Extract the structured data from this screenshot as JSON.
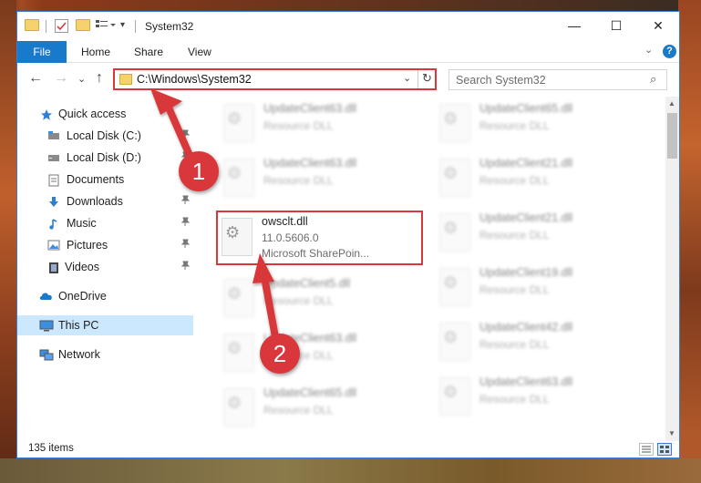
{
  "window": {
    "title": "System32",
    "controls": {
      "minimize": "—",
      "maximize": "☐",
      "close": "✕"
    }
  },
  "ribbon": {
    "tabs": [
      "File",
      "Home",
      "Share",
      "View"
    ],
    "expand_chevron": "⌄",
    "help": "?"
  },
  "address": {
    "back": "←",
    "forward": "→",
    "recent": "⌄",
    "up": "↑",
    "path": "C:\\Windows\\System32",
    "dropdown": "⌄",
    "refresh": "↻"
  },
  "search": {
    "placeholder": "Search System32",
    "icon": "⌕"
  },
  "sidebar": {
    "items": [
      {
        "label": "Quick access",
        "icon": "star-icon"
      },
      {
        "label": "Local Disk (C:)",
        "icon": "drive-icon",
        "pinned": true
      },
      {
        "label": "Local Disk (D:)",
        "icon": "drive-icon",
        "pinned": true
      },
      {
        "label": "Documents",
        "icon": "documents-icon",
        "pinned": true
      },
      {
        "label": "Downloads",
        "icon": "downloads-icon",
        "pinned": true
      },
      {
        "label": "Music",
        "icon": "music-icon",
        "pinned": true
      },
      {
        "label": "Pictures",
        "icon": "pictures-icon",
        "pinned": true
      },
      {
        "label": "Videos",
        "icon": "videos-icon",
        "pinned": true
      },
      {
        "label": "OneDrive",
        "icon": "cloud-icon"
      },
      {
        "label": "This PC",
        "icon": "pc-icon",
        "selected": true
      },
      {
        "label": "Network",
        "icon": "network-icon"
      }
    ],
    "pin_glyph": "📌"
  },
  "files": {
    "highlighted": {
      "name": "owsclt.dll",
      "version": "11.0.5606.0",
      "description": "Microsoft SharePoin..."
    },
    "blurred": [
      {
        "name": "UpdateClient63.dll",
        "type": "Resource DLL"
      },
      {
        "name": "UpdateClient65.dll",
        "type": "Resource DLL"
      },
      {
        "name": "UpdateClient63.dll",
        "type": "Resource DLL"
      },
      {
        "name": "UpdateClient21.dll",
        "type": "Resource DLL"
      },
      {
        "name": "UpdateClient21.dll",
        "type": "Resource DLL"
      },
      {
        "name": "UpdateClient5.dll",
        "type": "Resource DLL"
      },
      {
        "name": "UpdateClient19.dll",
        "type": "Resource DLL"
      },
      {
        "name": "UpdateClient63.dll",
        "type": "Resource DLL"
      },
      {
        "name": "UpdateClient42.dll",
        "type": "Resource DLL"
      },
      {
        "name": "UpdateClient65.dll",
        "type": "Resource DLL"
      },
      {
        "name": "UpdateClient63.dll",
        "type": "Resource DLL"
      }
    ]
  },
  "status": {
    "item_count": "135 items"
  },
  "annotations": {
    "step1": "1",
    "step2": "2"
  },
  "colors": {
    "accent": "#1979ca",
    "highlight_red": "#d9373b",
    "selected_bg": "#cce8ff"
  }
}
